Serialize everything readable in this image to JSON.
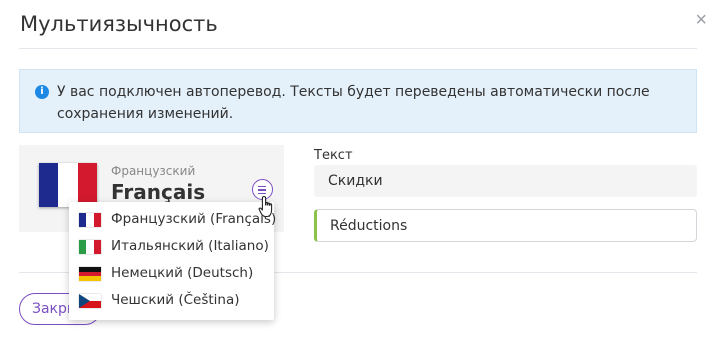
{
  "modal": {
    "title": "Мультиязычность",
    "close_icon": "×"
  },
  "alert": {
    "icon": "info-icon",
    "text": "У вас подключен автоперевод. Тексты будет переведены автоматически после сохранения изменений."
  },
  "language_card": {
    "subtitle": "Французский",
    "title": "Français",
    "flag_colors": [
      "#1f2a8f",
      "#ffffff",
      "#d2192d"
    ]
  },
  "field": {
    "label": "Текст",
    "original_value": "Скидки",
    "translated_value": "Réductions"
  },
  "dropdown": {
    "items": [
      {
        "label": "Французский (Français)",
        "flag": "flag-fr"
      },
      {
        "label": "Итальянский (Italiano)",
        "flag": "flag-it"
      },
      {
        "label": "Немецкий (Deutsch)",
        "flag": "flag-de"
      },
      {
        "label": "Чешский (Čeština)",
        "flag": "flag-cz"
      }
    ]
  },
  "footer": {
    "close_label": "Закрыть"
  },
  "colors": {
    "accent": "#7b4fc4",
    "info": "#1e88e5",
    "alert_bg": "#e4f1fb",
    "success": "#8bc34a"
  }
}
